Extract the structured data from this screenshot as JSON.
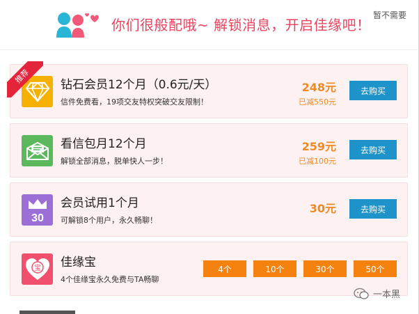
{
  "header": {
    "title": "你们很般配哦~  解锁消息，开启佳缘吧！",
    "skip_label": "暂不需要"
  },
  "ribbon_label": "推荐",
  "products": [
    {
      "title": "钻石会员12个月（0.6元/天）",
      "desc": "信件免费看，19项交友特权突破交友限制！",
      "price": "248元",
      "saved": "已减550元",
      "button": "去购买",
      "icon": "diamond-icon",
      "icon_color": "#f5b000"
    },
    {
      "title": "看信包月12个月",
      "desc": "解锁全部消息，脱单快人一步！",
      "price": "259元",
      "saved": "已减100元",
      "button": "去购买",
      "icon": "envelope-icon",
      "icon_color": "#5cb85c"
    },
    {
      "title": "会员试用1个月",
      "desc": "可解锁8个用户，永久畅聊！",
      "price": "30元",
      "button": "去购买",
      "icon": "crown-icon",
      "icon_badge": "30",
      "icon_color": "#9b6fd6"
    },
    {
      "title": "佳缘宝",
      "desc": "4个佳缘宝永久免费与TA畅聊",
      "icon": "heart-coin-icon",
      "icon_badge": "宝",
      "icon_color": "#f0506e",
      "options": [
        "4个",
        "10个",
        "30个",
        "50个"
      ]
    }
  ],
  "watermark": "一本黑",
  "colors": {
    "accent_pink": "#e9445f",
    "price_orange": "#f08a25",
    "buy_blue": "#1e93c9",
    "option_orange": "#f5820f",
    "card_bg": "#fdf1f1"
  }
}
